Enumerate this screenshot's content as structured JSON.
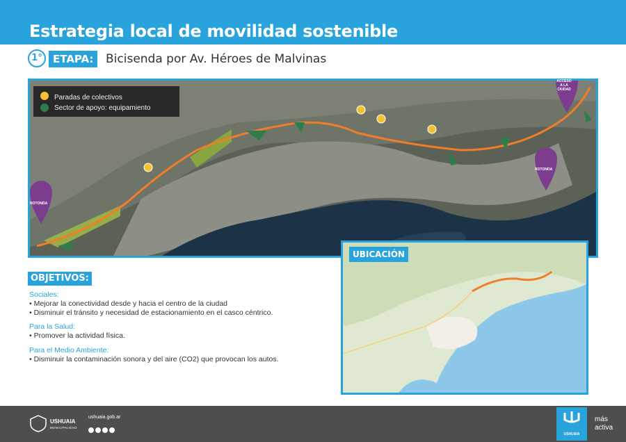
{
  "header": {
    "title": "Estrategia local de movilidad sostenible"
  },
  "stage": {
    "number": "1°",
    "tag": "ETAPA:",
    "title": "Bicisenda por Av. Héroes de Malvinas"
  },
  "map": {
    "legend": {
      "bus_stops": "Paradas de colectivos",
      "support": "Sector de apoyo: equipamiento"
    },
    "rotonda_left": "ROTONDA",
    "rotonda_right": "ROTONDA",
    "acceso_l1": "ACCESO",
    "acceso_l2": "A LA",
    "acceso_l3": "CIUDAD",
    "colors": {
      "route": "#f07d28",
      "pin": "#7c3d8f",
      "support": "#2e7d4a",
      "bus": "#f2c230",
      "water": "#1c3247"
    }
  },
  "objetivos": {
    "title": "OBJETIVOS:",
    "groups": [
      {
        "cat": "Sociales:",
        "items": [
          "• Mejorar la conectividad desde y hacia el centro de la ciudad",
          "• Disminuir el tránsito y necesidad de estacionamiento en el casco céntrico."
        ]
      },
      {
        "cat": "Para la Salud:",
        "items": [
          "• Promover la actividad física."
        ]
      },
      {
        "cat": "Para el Medio Ambiente:",
        "items": [
          "• Disminuir la contaminación sonora y del aire (CO2) que provocan los autos."
        ]
      }
    ]
  },
  "ubicacion": {
    "title": "UBICACIÓN"
  },
  "footer": {
    "logo_name": "USHUAIA",
    "logo_sub": "MUNICIPALIDAD",
    "web": "ushuaia.gob.ar",
    "brand": "USHUAIA",
    "slogan_1": "más",
    "slogan_2": "activa"
  }
}
